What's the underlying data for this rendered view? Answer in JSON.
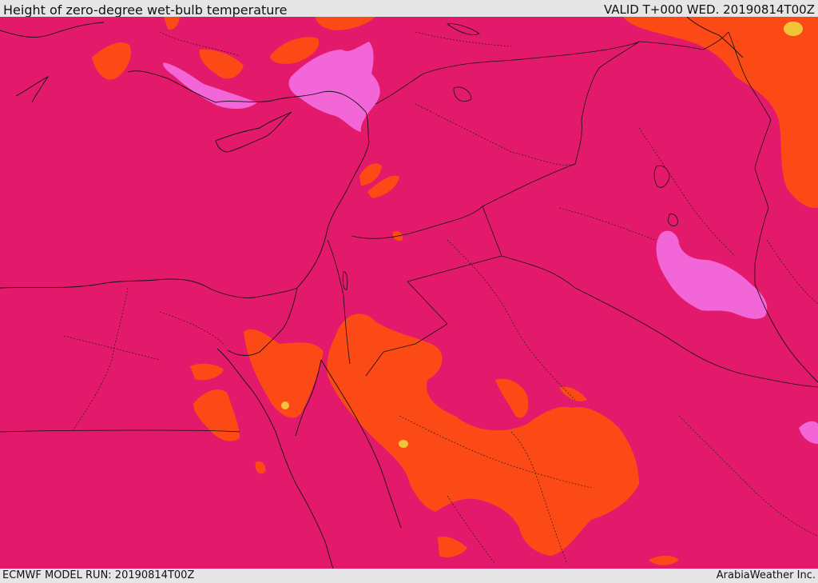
{
  "header": {
    "title": "Height of zero-degree wet-bulb temperature",
    "valid": "VALID T+000 WED. 20190814T00Z"
  },
  "footer": {
    "model_run": "ECMWF MODEL RUN: 20190814T00Z",
    "credit": "ArabiaWeather Inc."
  },
  "colors": {
    "base_field": "#e3196c",
    "orange_field": "#fb4a16",
    "pink_field": "#f266d8",
    "yellow_field": "#f2c43a",
    "borders": "#111111"
  }
}
